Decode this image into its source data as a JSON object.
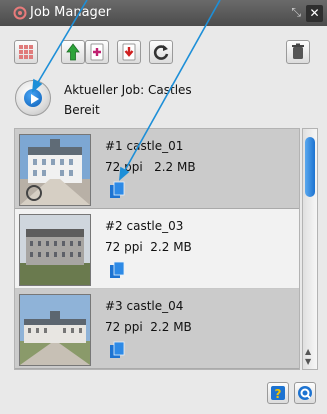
{
  "window": {
    "title": "Job Manager",
    "controls": {
      "resize_icon": "resize-icon",
      "close_label": "✕"
    }
  },
  "toolbar": {
    "buttons": [
      {
        "name": "thumbnail-grid-button",
        "icon": "grid-icon"
      },
      {
        "name": "move-up-button",
        "icon": "arrow-up-icon"
      },
      {
        "name": "add-job-button",
        "icon": "add-document-icon"
      },
      {
        "name": "remove-job-button",
        "icon": "remove-document-icon"
      },
      {
        "name": "refresh-button",
        "icon": "refresh-icon"
      },
      {
        "name": "trash-button",
        "icon": "trash-icon"
      }
    ]
  },
  "job": {
    "label": "Aktueller Job: Castles",
    "status": "Bereit"
  },
  "items": [
    {
      "name": "#1 castle_01",
      "resolution": "72 ppi",
      "size": "2.2 MB",
      "selected": true
    },
    {
      "name": "#2 castle_03",
      "resolution": "72 ppi",
      "size": "2.2 MB",
      "selected": false
    },
    {
      "name": "#3 castle_04",
      "resolution": "72 ppi",
      "size": "2.2 MB",
      "selected": false
    }
  ],
  "bottom": {
    "help_icon": "help-icon",
    "settings_icon": "settings-icon"
  },
  "colors": {
    "accent": "#1d73d1",
    "selected_row": "#cbcbcb",
    "row_alt": "#f2f2f2",
    "titlebar": "#555555"
  }
}
